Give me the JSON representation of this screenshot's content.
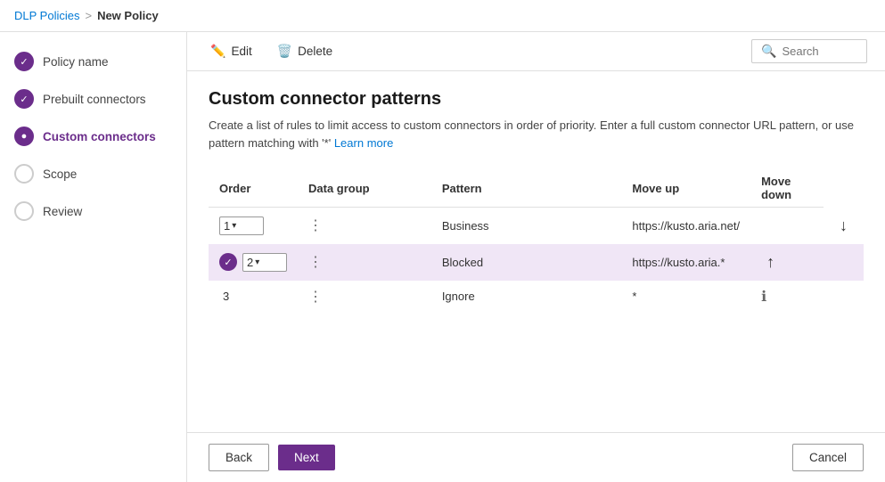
{
  "breadcrumb": {
    "parent": "DLP Policies",
    "separator": ">",
    "current": "New Policy"
  },
  "sidebar": {
    "items": [
      {
        "id": "policy-name",
        "label": "Policy name",
        "state": "completed"
      },
      {
        "id": "prebuilt-connectors",
        "label": "Prebuilt connectors",
        "state": "completed"
      },
      {
        "id": "custom-connectors",
        "label": "Custom connectors",
        "state": "active"
      },
      {
        "id": "scope",
        "label": "Scope",
        "state": "default"
      },
      {
        "id": "review",
        "label": "Review",
        "state": "default"
      }
    ]
  },
  "toolbar": {
    "edit_label": "Edit",
    "delete_label": "Delete",
    "search_placeholder": "Search"
  },
  "page": {
    "title": "Custom connector patterns",
    "description": "Create a list of rules to limit access to custom connectors in order of priority. Enter a full custom connector URL pattern, or use pattern matching with '*'",
    "learn_more": "Learn more"
  },
  "table": {
    "columns": {
      "order": "Order",
      "data_group": "Data group",
      "pattern": "Pattern",
      "move_up": "Move up",
      "move_down": "Move down"
    },
    "rows": [
      {
        "order": "1",
        "has_dropdown": true,
        "has_check": false,
        "data_group": "Business",
        "pattern": "https://kusto.aria.net/",
        "has_move_up": false,
        "has_move_down": true,
        "highlighted": false,
        "has_info": false
      },
      {
        "order": "2",
        "has_dropdown": true,
        "has_check": true,
        "data_group": "Blocked",
        "pattern": "https://kusto.aria.*",
        "has_move_up": true,
        "has_move_down": false,
        "highlighted": true,
        "has_info": false
      },
      {
        "order": "3",
        "has_dropdown": false,
        "has_check": false,
        "data_group": "Ignore",
        "pattern": "*",
        "has_move_up": false,
        "has_move_down": false,
        "highlighted": false,
        "has_info": true
      }
    ]
  },
  "footer": {
    "back_label": "Back",
    "next_label": "Next",
    "cancel_label": "Cancel"
  }
}
